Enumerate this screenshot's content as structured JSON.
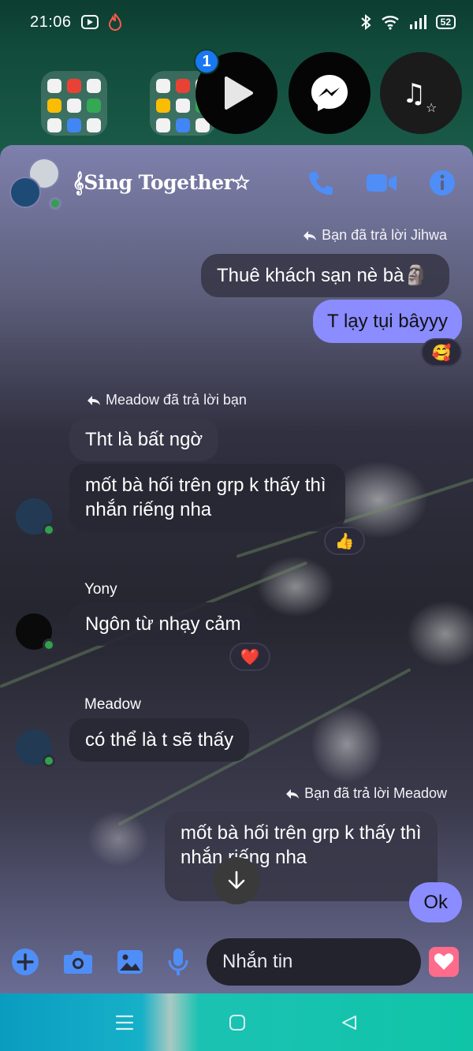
{
  "status_bar": {
    "time": "21:06",
    "battery": "52"
  },
  "home": {
    "notification_count": "1"
  },
  "chat": {
    "title": "𝄞Sing Together☆",
    "messages": [
      {
        "type": "reply_note",
        "text": "Bạn đã trả lời Jihwa"
      },
      {
        "type": "quoted",
        "text": "Thuê khách sạn nè bà🗿"
      },
      {
        "type": "outgoing",
        "text": "T lạy tụi bâyyy",
        "reaction": "🥰"
      },
      {
        "type": "reply_note",
        "text": "Meadow đã trả lời bạn"
      },
      {
        "type": "quoted",
        "text": "Tht là bất ngờ"
      },
      {
        "type": "incoming",
        "lines": [
          "mốt bà hối trên grp k thấy thì",
          "nhắn riếng nha"
        ],
        "reaction": "👍"
      },
      {
        "type": "sender",
        "text": "Yony"
      },
      {
        "type": "incoming",
        "text": "Ngôn từ nhạy cảm",
        "reaction": "❤️"
      },
      {
        "type": "sender",
        "text": "Meadow"
      },
      {
        "type": "incoming",
        "text": "có thể là t sẽ thấy"
      },
      {
        "type": "reply_note",
        "text": "Bạn đã trả lời Meadow"
      },
      {
        "type": "quoted",
        "lines": [
          "mốt bà hối trên grp k thấy thì",
          "nhắn riếng nha"
        ]
      },
      {
        "type": "outgoing",
        "text": "Ok"
      }
    ]
  },
  "composer": {
    "placeholder": "Nhắn tin"
  },
  "colors": {
    "accent": "#8a8cff",
    "header_icons": "#4f8ef7",
    "online": "#31a24c",
    "heart": "#ff6b8b"
  },
  "icons": [
    "phone-icon",
    "video-camera-icon",
    "info-icon",
    "plus-icon",
    "camera-icon",
    "image-icon",
    "microphone-icon",
    "emoji-icon",
    "heart-icon",
    "scroll-down-arrow-icon"
  ]
}
